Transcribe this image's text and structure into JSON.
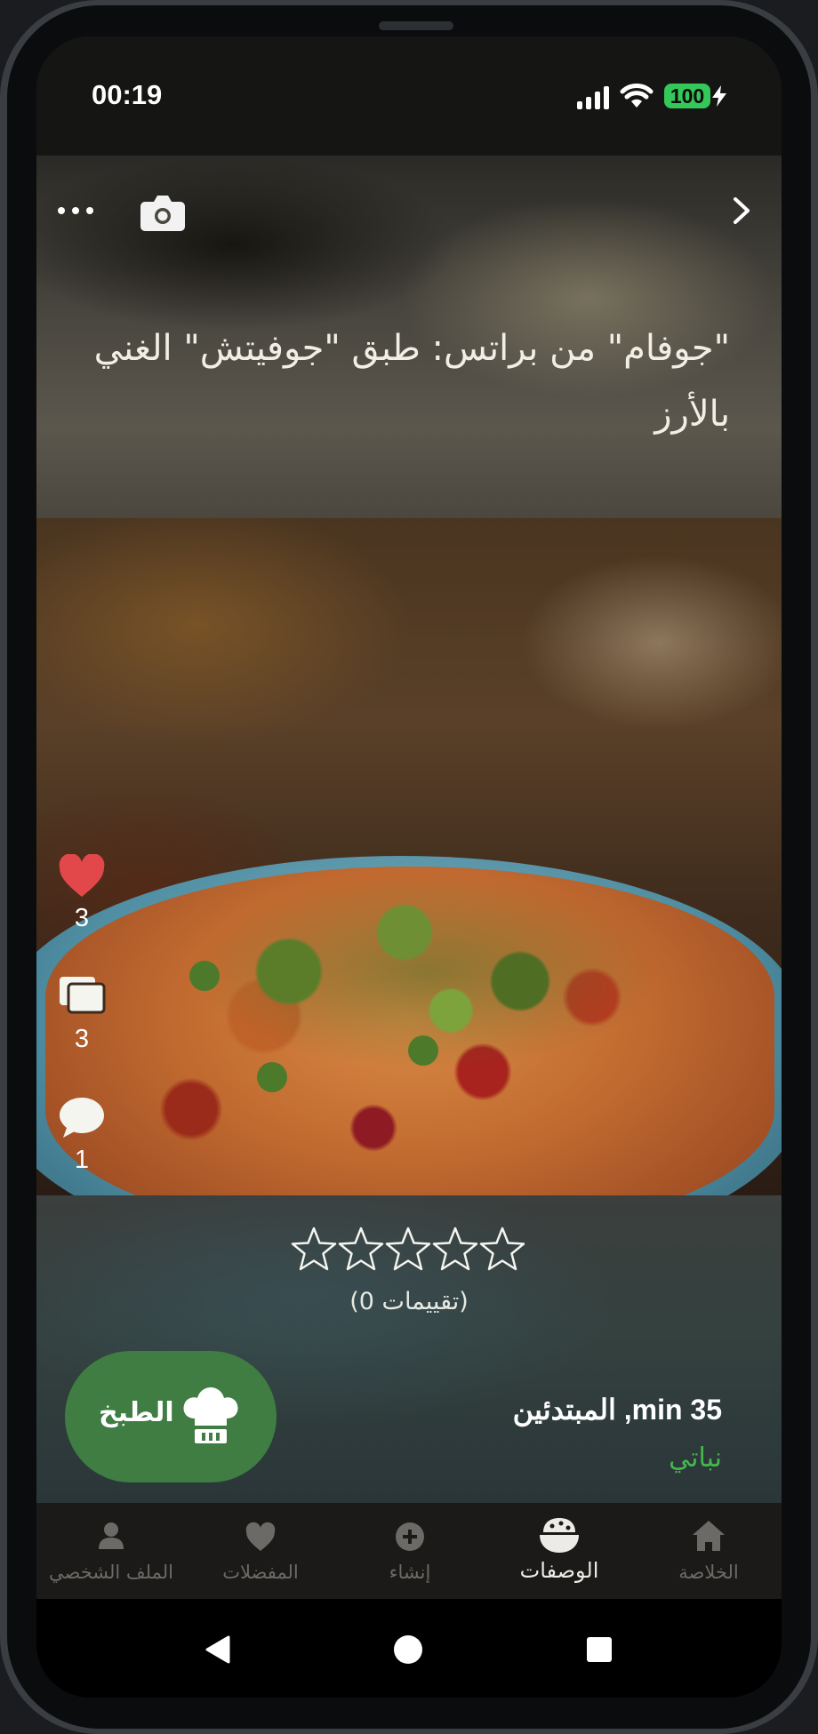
{
  "status_bar": {
    "time": "00:19",
    "battery": "100"
  },
  "header": {
    "title": "\"جوفام\" من براتس: طبق \"جوفيتش\" الغني بالأرز",
    "icons": [
      "more-icon",
      "camera-icon",
      "chevron-right-icon"
    ]
  },
  "recipe": {
    "likes": "3",
    "collections": "3",
    "comments": "1",
    "rating_stars": 0,
    "rating_max": 5,
    "ratings_label": "(تقييمات 0)",
    "cook_label": "الطبخ",
    "time_level": "35 min, المبتدئين",
    "diet": "نباتي"
  },
  "colors": {
    "accent_green": "#3f7d43",
    "diet_green": "#47b64f",
    "heart_red": "#e2484a"
  },
  "bottom_nav": {
    "items": [
      {
        "label": "الملف الشخصي",
        "icon": "profile-icon",
        "active": false
      },
      {
        "label": "المفضلات",
        "icon": "heart-icon",
        "active": false
      },
      {
        "label": "إنشاء",
        "icon": "plus-circle-icon",
        "active": false
      },
      {
        "label": "الوصفات",
        "icon": "recipes-icon",
        "active": true
      },
      {
        "label": "الخلاصة",
        "icon": "home-icon",
        "active": false
      }
    ]
  }
}
